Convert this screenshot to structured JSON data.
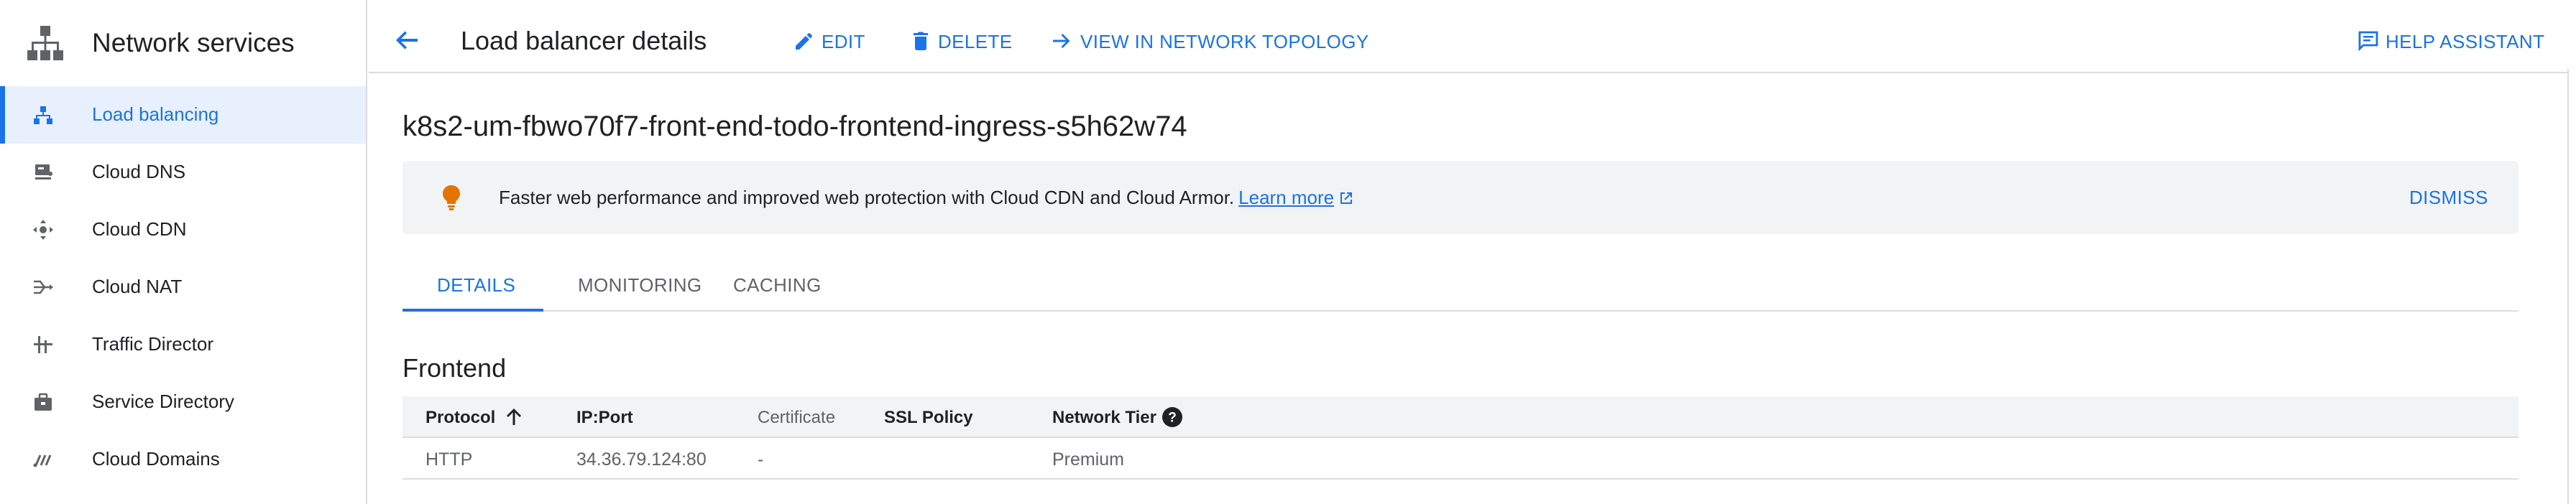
{
  "sidebar": {
    "product_title": "Network services",
    "items": [
      {
        "label": "Load balancing",
        "icon": "load-balancing-icon",
        "active": true
      },
      {
        "label": "Cloud DNS",
        "icon": "cloud-dns-icon"
      },
      {
        "label": "Cloud CDN",
        "icon": "cloud-cdn-icon"
      },
      {
        "label": "Cloud NAT",
        "icon": "cloud-nat-icon"
      },
      {
        "label": "Traffic Director",
        "icon": "traffic-director-icon"
      },
      {
        "label": "Service Directory",
        "icon": "service-directory-icon"
      },
      {
        "label": "Cloud Domains",
        "icon": "cloud-domains-icon"
      }
    ]
  },
  "header": {
    "title": "Load balancer details",
    "edit_label": "EDIT",
    "delete_label": "DELETE",
    "topology_label": "VIEW IN NETWORK TOPOLOGY",
    "help_label": "HELP ASSISTANT"
  },
  "main": {
    "lb_name": "k8s2-um-fbwo70f7-front-end-todo-frontend-ingress-s5h62w74",
    "banner": {
      "text": "Faster web performance and improved web protection with Cloud CDN and Cloud Armor.",
      "link": "Learn more",
      "dismiss": "DISMISS"
    },
    "tabs": [
      {
        "label": "DETAILS",
        "active": true
      },
      {
        "label": "MONITORING"
      },
      {
        "label": "CACHING"
      }
    ],
    "section_title": "Frontend",
    "table": {
      "columns": [
        "Protocol",
        "IP:Port",
        "Certificate",
        "SSL Policy",
        "Network Tier"
      ],
      "rows": [
        [
          "HTTP",
          "34.36.79.124:80",
          "-",
          "",
          "Premium"
        ]
      ]
    }
  },
  "colors": {
    "accent": "#1a73e8",
    "active_bg": "#e8f0fe",
    "banner_bg": "#f1f3f4",
    "bulb": "#e37400",
    "divider": "#dadce0"
  }
}
